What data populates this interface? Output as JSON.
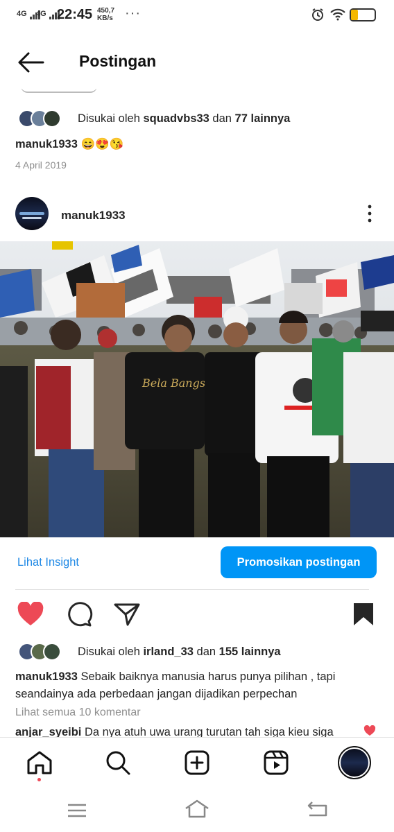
{
  "status": {
    "net1": "4G",
    "net2": "4G",
    "time": "22:45",
    "speed_value": "450,7",
    "speed_unit": "KB/s",
    "more": "···",
    "battery_level": 0.3,
    "battery_color": "#f5b800"
  },
  "header": {
    "title": "Postingan"
  },
  "prev_post": {
    "likes_prefix": "Disukai oleh ",
    "likes_user": "squadvbs33",
    "likes_middle": " dan ",
    "likes_count": "77 lainnya",
    "caption_user": "manuk1933",
    "caption_text": " 😄😍😘",
    "date": "4 April 2019"
  },
  "post": {
    "username": "manuk1933",
    "insight_label": "Lihat Insight",
    "promote_label": "Promosikan postingan",
    "liked": true,
    "likes_prefix": "Disukai oleh ",
    "likes_user": "irland_33",
    "likes_middle": " dan ",
    "likes_count": "155 lainnya",
    "caption_user": "manuk1933",
    "caption_text": " Sebaik baiknya manusia harus punya pilihan , tapi seandainya ada perbedaan jangan dijadikan perpechan",
    "view_comments": "Lihat semua 10 komentar",
    "comment_user": "anjar_syeibi",
    "comment_text": " Da nya atuh uwa urang turutan tah siga kieu siga"
  },
  "icons": {
    "heart": "heart-icon",
    "comment": "comment-icon",
    "share": "send-icon",
    "save": "bookmark-icon"
  },
  "colors": {
    "like_red": "#ed4956",
    "accent": "#0095f6",
    "link": "#1e88e5"
  }
}
